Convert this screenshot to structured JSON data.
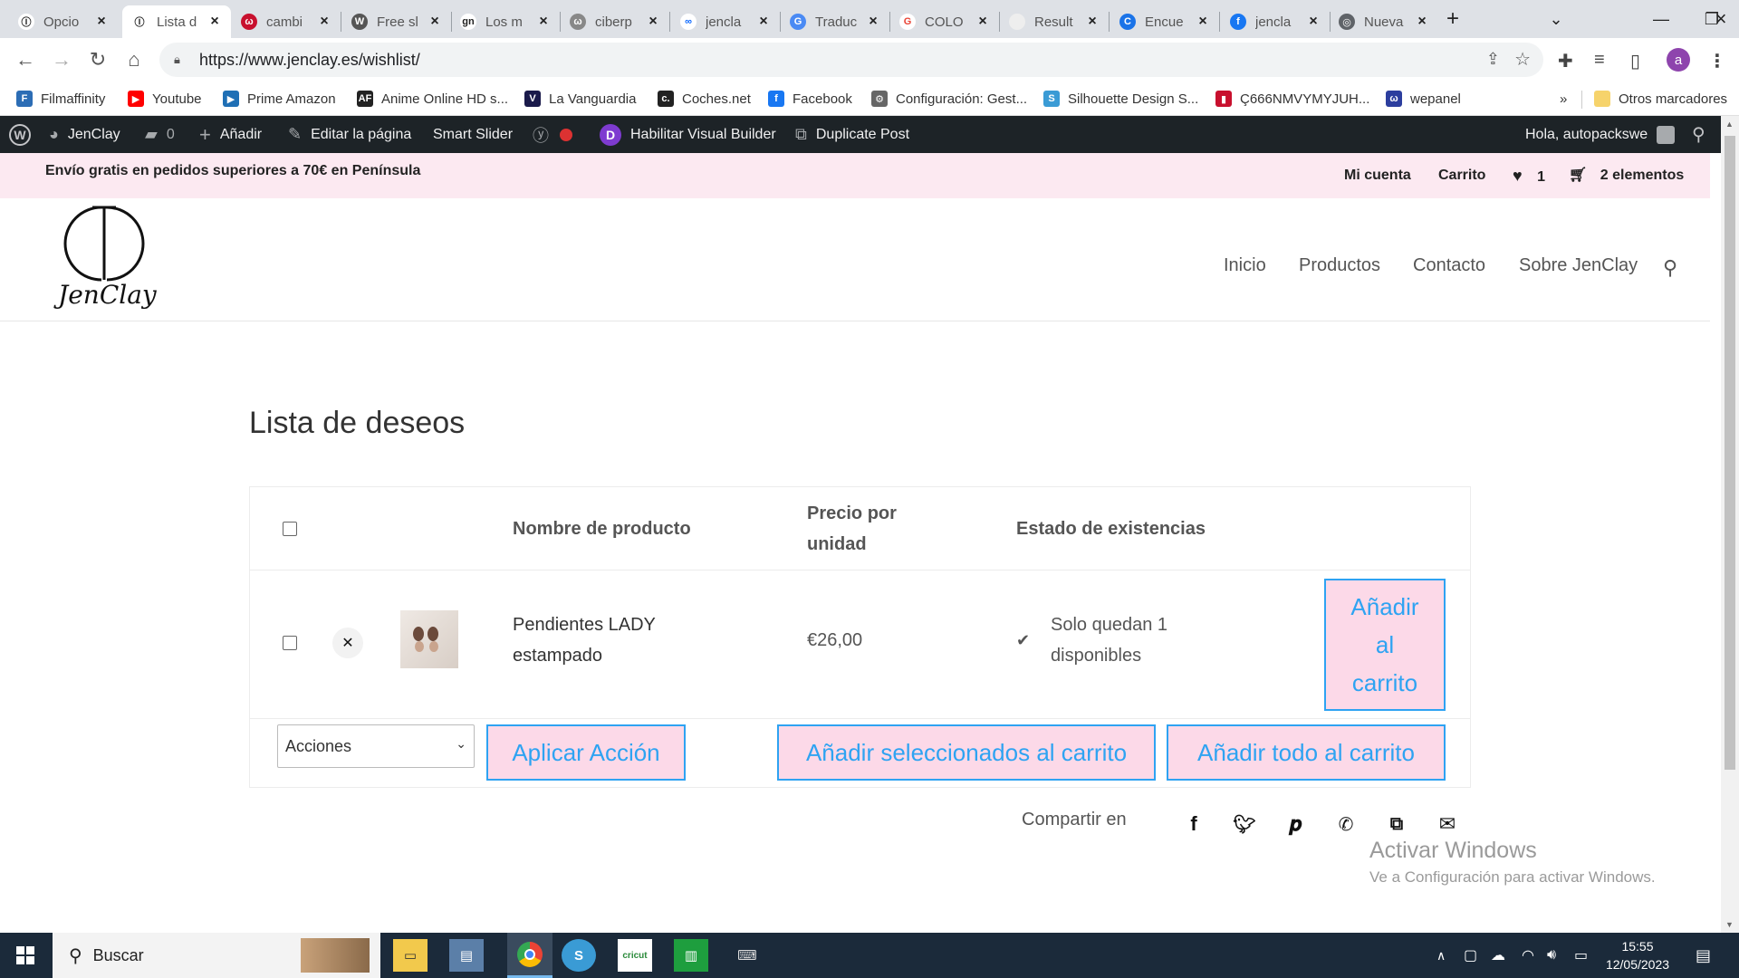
{
  "browser": {
    "tabs": [
      {
        "title": "Opcio",
        "fav_color": "#ffffff",
        "fav_text": "Ⓘ",
        "fav_fg": "#222"
      },
      {
        "title": "Lista d",
        "fav_color": "#ffffff",
        "fav_text": "Ⓘ",
        "fav_fg": "#222"
      },
      {
        "title": "cambi",
        "fav_color": "#c8102e",
        "fav_text": "ω",
        "fav_fg": "#fff"
      },
      {
        "title": "Free sl",
        "fav_color": "#555555",
        "fav_text": "W",
        "fav_fg": "#fff"
      },
      {
        "title": "Los m",
        "fav_color": "#ffffff",
        "fav_text": "gn",
        "fav_fg": "#222"
      },
      {
        "title": "ciberp",
        "fav_color": "#888888",
        "fav_text": "ω",
        "fav_fg": "#fff"
      },
      {
        "title": "jencla",
        "fav_color": "#ffffff",
        "fav_text": "∞",
        "fav_fg": "#0866ff"
      },
      {
        "title": "Traduc",
        "fav_color": "#4a8af4",
        "fav_text": "G",
        "fav_fg": "#fff"
      },
      {
        "title": "COLO",
        "fav_color": "#ffffff",
        "fav_text": "G",
        "fav_fg": "#ea4335"
      },
      {
        "title": "Result",
        "fav_color": "#eeeeee",
        "fav_text": "",
        "fav_fg": "#fff"
      },
      {
        "title": "Encue",
        "fav_color": "#1a73e8",
        "fav_text": "C",
        "fav_fg": "#fff"
      },
      {
        "title": "jencla",
        "fav_color": "#1877f2",
        "fav_text": "f",
        "fav_fg": "#fff"
      },
      {
        "title": "Nueva",
        "fav_color": "#5f6368",
        "fav_text": "◎",
        "fav_fg": "#fff"
      }
    ],
    "close_glyph": "×",
    "new_tab_glyph": "+",
    "url": "https://www.jenclay.es/wishlist/",
    "profile_initial": "a",
    "bookmarks": [
      {
        "label": "Filmaffinity",
        "color": "#2c6db5",
        "glyph": "F"
      },
      {
        "label": "Youtube",
        "color": "#ff0000",
        "glyph": "▶"
      },
      {
        "label": "Prime Amazon",
        "color": "#1f6fb5",
        "glyph": "▶"
      },
      {
        "label": "Anime Online HD s...",
        "color": "#222222",
        "glyph": "AF"
      },
      {
        "label": "La Vanguardia",
        "color": "#1a1a4a",
        "glyph": "V"
      },
      {
        "label": "Coches.net",
        "color": "#222222",
        "glyph": "c."
      },
      {
        "label": "Facebook",
        "color": "#1877f2",
        "glyph": "f"
      },
      {
        "label": "Configuración: Gest...",
        "color": "#666666",
        "glyph": "⚙"
      },
      {
        "label": "Silhouette Design S...",
        "color": "#3a9bd5",
        "glyph": "S"
      },
      {
        "label": "Ç666NMVYMYJUH...",
        "color": "#c8102e",
        "glyph": "▮"
      },
      {
        "label": "wepanel",
        "color": "#2c3e9e",
        "glyph": "ω"
      }
    ],
    "bookmarks_overflow": "»",
    "other_bookmarks": "Otros marcadores"
  },
  "wpbar": {
    "site_name": "JenClay",
    "comments_count": "0",
    "add_label": "Añadir",
    "edit_label": "Editar la página",
    "smart_slider": "Smart Slider",
    "visual_builder": "Habilitar Visual Builder",
    "duplicate": "Duplicate Post",
    "greeting": "Hola, autopackswe"
  },
  "topbar": {
    "promo": "Envío gratis en pedidos superiores a 70€ en Península",
    "account": "Mi cuenta",
    "cart": "Carrito",
    "wishlist_count": "1",
    "cart_items": "2 elementos"
  },
  "logo": {
    "text": "JenClay"
  },
  "nav": [
    "Inicio",
    "Productos",
    "Contacto",
    "Sobre JenClay"
  ],
  "wishlist": {
    "title": "Lista de deseos",
    "headers": {
      "product_name": "Nombre de producto",
      "price_line1": "Precio por",
      "price_line2": "unidad",
      "stock": "Estado de existencias"
    },
    "items": [
      {
        "name_line1": "Pendientes LADY",
        "name_line2": "estampado",
        "price": "€26,00",
        "stock_line1": "Solo quedan 1",
        "stock_line2": "disponibles",
        "add_line1": "Añadir",
        "add_line2": "al",
        "add_line3": "carrito"
      }
    ],
    "actions_select": "Acciones",
    "apply_action": "Aplicar Acción",
    "add_selected": "Añadir seleccionados al carrito",
    "add_all": "Añadir todo al carrito"
  },
  "share": {
    "label": "Compartir en"
  },
  "watermark": {
    "line1": "Activar Windows",
    "line2": "Ve a Configuración para activar Windows."
  },
  "taskbar": {
    "search_placeholder": "Buscar",
    "time": "15:55",
    "date": "12/05/2023"
  }
}
